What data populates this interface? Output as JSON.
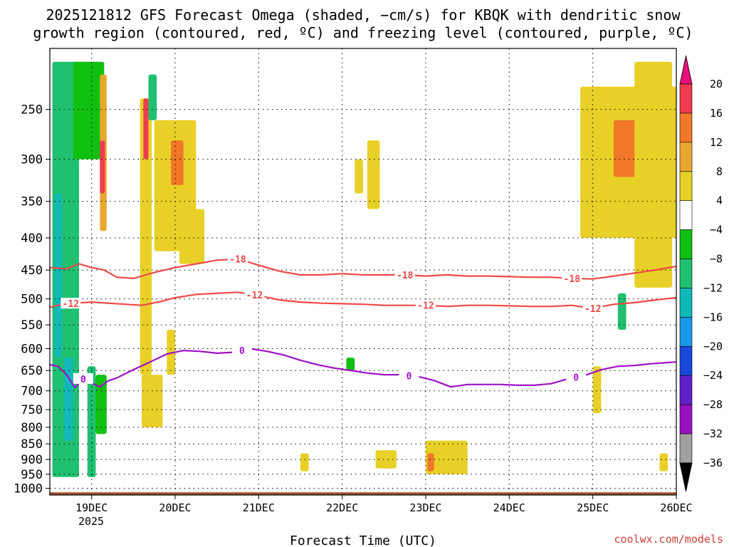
{
  "title": {
    "line1": "2025121812 GFS Forecast Omega (shaded, −cm/s) for KBQK with dendritic snow",
    "line2": "growth region (contoured, red, ºC) and freezing level (contoured, purple, ºC)"
  },
  "credit": "coolwx.com/models",
  "colors": {
    "red_contour": "#f04848",
    "purple_contour": "#a010c8",
    "ground": "#a0522d",
    "grid": "#777777"
  },
  "chart_data": {
    "type": "heatmap",
    "title": "2025121812 GFS Forecast Omega (shaded, −cm/s) for KBQK with dendritic snow growth region (contoured, red, ºC) and freezing level (contoured, purple, ºC)",
    "xlabel": "Forecast Time (UTC)",
    "ylabel": "",
    "x_ticks": [
      "19DEC",
      "20DEC",
      "21DEC",
      "22DEC",
      "23DEC",
      "24DEC",
      "25DEC",
      "26DEC"
    ],
    "x_tick_year": "2025",
    "x_tick_values": [
      18.0,
      19.0,
      20.0,
      21.0,
      22.0,
      23.0,
      24.0,
      25.0
    ],
    "xlim": [
      -0.5,
      7.0
    ],
    "y_ticks": [
      "250",
      "300",
      "350",
      "400",
      "450",
      "500",
      "550",
      "600",
      "650",
      "700",
      "750",
      "800",
      "850",
      "900",
      "950",
      "1000"
    ],
    "ylim_hpa": [
      1025,
      200
    ],
    "y_scale": "log-pressure",
    "grid": true,
    "colorbar": {
      "labels": [
        "20",
        "16",
        "12",
        "8",
        "4",
        "−4",
        "−8",
        "−12",
        "−16",
        "−20",
        "−24",
        "−28",
        "−32",
        "−36"
      ],
      "colors": [
        "#f03c50",
        "#f07828",
        "#e8a830",
        "#e8d028",
        "#ffffff",
        "#10c010",
        "#20c070",
        "#10b8b8",
        "#1898e8",
        "#1848d8",
        "#6020c8",
        "#9a10c0",
        "#a0a0a0"
      ],
      "top_arrow_color": "#e8107a",
      "bottom_arrow_color": "#000000"
    },
    "contours": {
      "dendritic_minus18_hpa": {
        "label": "-18",
        "label_positions_days": [
          1.75,
          3.75,
          5.75
        ],
        "x_days": [
          -0.5,
          -0.3,
          -0.15,
          0.0,
          0.15,
          0.3,
          0.5,
          0.75,
          1.0,
          1.25,
          1.5,
          1.75,
          2.0,
          2.25,
          2.5,
          2.75,
          3.0,
          3.25,
          3.5,
          3.75,
          4.0,
          4.25,
          4.5,
          4.75,
          5.0,
          5.25,
          5.5,
          5.75,
          6.0,
          6.25,
          6.5,
          6.75,
          7.0
        ],
        "values": [
          446,
          448,
          440,
          446,
          450,
          462,
          464,
          454,
          446,
          440,
          434,
          432,
          442,
          452,
          458,
          458,
          456,
          458,
          458,
          458,
          460,
          458,
          460,
          460,
          461,
          462,
          462,
          464,
          465,
          460,
          455,
          450,
          444
        ]
      },
      "dendritic_minus12_hpa": {
        "label": "-12",
        "label_positions_days": [
          -0.25,
          1.95,
          4.0,
          6.0
        ],
        "x_days": [
          -0.5,
          -0.35,
          -0.2,
          0.0,
          0.2,
          0.4,
          0.6,
          0.8,
          1.0,
          1.25,
          1.5,
          1.75,
          2.0,
          2.25,
          2.5,
          2.75,
          3.0,
          3.25,
          3.5,
          3.75,
          4.0,
          4.25,
          4.5,
          4.75,
          5.0,
          5.25,
          5.5,
          5.75,
          6.0,
          6.25,
          6.5,
          6.75,
          7.0
        ],
        "values": [
          516,
          510,
          508,
          506,
          508,
          510,
          512,
          506,
          498,
          492,
          490,
          488,
          494,
          502,
          506,
          508,
          509,
          510,
          512,
          512,
          512,
          514,
          512,
          512,
          513,
          514,
          514,
          512,
          518,
          510,
          507,
          502,
          498
        ]
      },
      "freezing_level_0C_hpa": {
        "label": "0",
        "label_positions_days": [
          -0.1,
          1.8,
          3.8,
          5.8
        ],
        "x_days": [
          -0.5,
          -0.4,
          -0.3,
          -0.2,
          -0.1,
          0.0,
          0.1,
          0.2,
          0.3,
          0.5,
          0.7,
          0.9,
          1.1,
          1.3,
          1.5,
          1.7,
          1.9,
          2.1,
          2.3,
          2.5,
          2.7,
          2.9,
          3.1,
          3.3,
          3.5,
          3.7,
          3.9,
          4.1,
          4.3,
          4.5,
          4.7,
          4.9,
          5.1,
          5.3,
          5.5,
          5.7,
          5.9,
          6.1,
          6.3,
          6.5,
          6.7,
          7.0
        ],
        "values": [
          636,
          640,
          660,
          692,
          670,
          680,
          690,
          675,
          668,
          648,
          630,
          612,
          604,
          606,
          610,
          608,
          600,
          606,
          614,
          626,
          636,
          644,
          650,
          656,
          660,
          660,
          664,
          674,
          690,
          684,
          684,
          684,
          686,
          686,
          682,
          670,
          662,
          648,
          640,
          638,
          634,
          630
        ]
      }
    },
    "ground_hpa": 1015,
    "omega_shading_regions": [
      {
        "x": [
          -0.47,
          -0.15
        ],
        "p": [
          210,
          960
        ],
        "value": -8
      },
      {
        "x": [
          -0.44,
          -0.36
        ],
        "p": [
          340,
          620
        ],
        "value": -14
      },
      {
        "x": [
          -0.33,
          -0.22
        ],
        "p": [
          620,
          840
        ],
        "value": -14
      },
      {
        "x": [
          -0.22,
          0.15
        ],
        "p": [
          210,
          300
        ],
        "value": -6
      },
      {
        "x": [
          -0.05,
          0.05
        ],
        "p": [
          640,
          960
        ],
        "value": -8
      },
      {
        "x": [
          0.05,
          0.18
        ],
        "p": [
          660,
          820
        ],
        "value": -6
      },
      {
        "x": [
          0.1,
          0.18
        ],
        "p": [
          220,
          390
        ],
        "value": 8
      },
      {
        "x": [
          0.1,
          0.16
        ],
        "p": [
          280,
          340
        ],
        "value": 20
      },
      {
        "x": [
          0.58,
          0.72
        ],
        "p": [
          240,
          660
        ],
        "value": 6
      },
      {
        "x": [
          0.62,
          0.68
        ],
        "p": [
          240,
          300
        ],
        "value": 16
      },
      {
        "x": [
          0.6,
          0.85
        ],
        "p": [
          660,
          800
        ],
        "value": 5
      },
      {
        "x": [
          0.68,
          0.78
        ],
        "p": [
          220,
          260
        ],
        "value": -8
      },
      {
        "x": [
          0.75,
          1.25
        ],
        "p": [
          260,
          420
        ],
        "value": 6
      },
      {
        "x": [
          0.95,
          1.1
        ],
        "p": [
          280,
          330
        ],
        "value": 12
      },
      {
        "x": [
          1.05,
          1.35
        ],
        "p": [
          360,
          440
        ],
        "value": 5
      },
      {
        "x": [
          0.9,
          1.0
        ],
        "p": [
          560,
          660
        ],
        "value": 5
      },
      {
        "x": [
          3.05,
          3.15
        ],
        "p": [
          620,
          650
        ],
        "value": -6
      },
      {
        "x": [
          3.4,
          3.65
        ],
        "p": [
          870,
          930
        ],
        "value": 6
      },
      {
        "x": [
          2.5,
          2.6
        ],
        "p": [
          880,
          940
        ],
        "value": 5
      },
      {
        "x": [
          4.0,
          4.5
        ],
        "p": [
          840,
          950
        ],
        "value": 6
      },
      {
        "x": [
          4.02,
          4.1
        ],
        "p": [
          880,
          940
        ],
        "value": 12
      },
      {
        "x": [
          3.3,
          3.45
        ],
        "p": [
          280,
          360
        ],
        "value": 5
      },
      {
        "x": [
          3.15,
          3.25
        ],
        "p": [
          300,
          340
        ],
        "value": 5
      },
      {
        "x": [
          6.3,
          6.4
        ],
        "p": [
          490,
          560
        ],
        "value": -8
      },
      {
        "x": [
          5.85,
          7.0
        ],
        "p": [
          230,
          400
        ],
        "value": 6
      },
      {
        "x": [
          6.25,
          6.55
        ],
        "p": [
          260,
          320
        ],
        "value": 12
      },
      {
        "x": [
          6.5,
          6.95
        ],
        "p": [
          210,
          480
        ],
        "value": 5
      },
      {
        "x": [
          6.0,
          6.1
        ],
        "p": [
          640,
          760
        ],
        "value": 6
      },
      {
        "x": [
          6.8,
          6.9
        ],
        "p": [
          880,
          940
        ],
        "value": 5
      }
    ]
  }
}
